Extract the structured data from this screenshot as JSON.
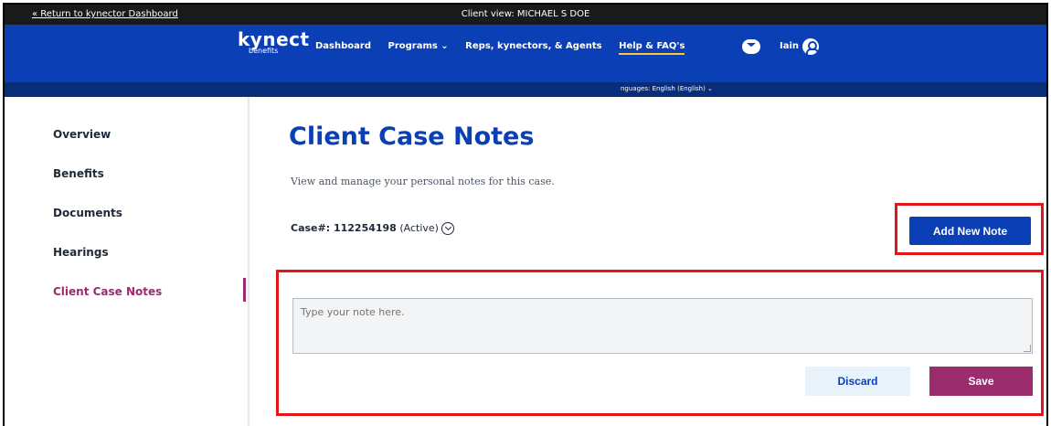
{
  "topbar": {
    "back_link": "« Return to kynector Dashboard",
    "client_view": "Client view: MICHAEL S DOE"
  },
  "nav": {
    "logo_main": "kynect",
    "logo_sub": "benefits",
    "links": [
      "Dashboard",
      "Programs ⌄",
      "Reps, kynectors, & Agents",
      "Help & FAQ's"
    ],
    "user_name": "Iain"
  },
  "langbar": {
    "language_label": "nguages:  English (English)  ⌄"
  },
  "sidebar": {
    "items": [
      "Overview",
      "Benefits",
      "Documents",
      "Hearings",
      "Client Case Notes"
    ]
  },
  "main": {
    "title": "Client Case Notes",
    "subtitle": "View and manage your personal notes for this case.",
    "case_label": "Case#: 112254198",
    "case_status": " (Active)",
    "add_button": "Add New Note",
    "note_placeholder": "Type your note here.",
    "discard_button": "Discard",
    "save_button": "Save"
  },
  "colors": {
    "brand_blue": "#0b3fb5",
    "accent_magenta": "#9b2c6e",
    "highlight_red": "#e4141b"
  }
}
